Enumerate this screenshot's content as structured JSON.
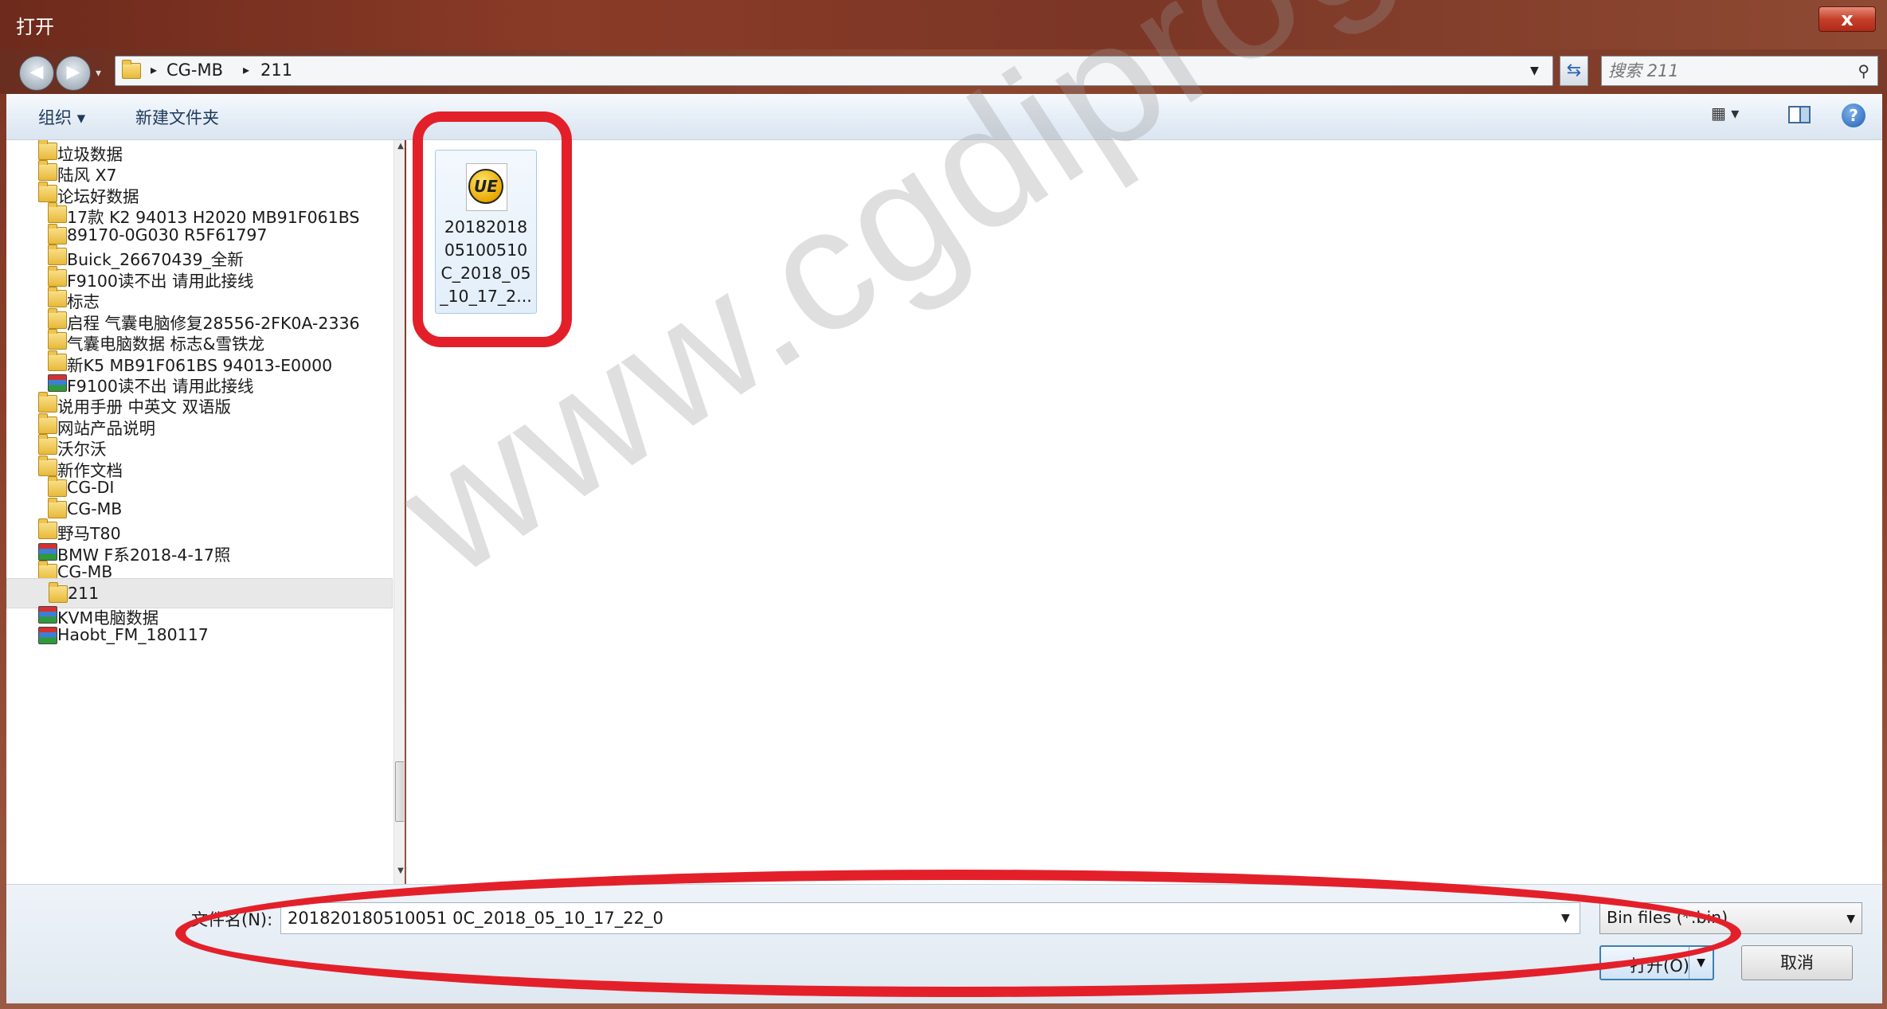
{
  "window": {
    "title": "打开",
    "close_label": "x"
  },
  "address": {
    "crumbs": [
      "CG-MB",
      "211"
    ],
    "search_placeholder": "搜索 211"
  },
  "toolbar": {
    "organize_label": "组织 ▾",
    "new_folder_label": "新建文件夹"
  },
  "nav_tree": [
    {
      "label": "垃圾数据",
      "icon": "folder-icon"
    },
    {
      "label": "陆风 X7",
      "icon": "folder-icon"
    },
    {
      "label": "论坛好数据",
      "icon": "folder-icon"
    },
    {
      "label": "17款 K2  94013 H2020 MB91F061BS",
      "icon": "folder-icon"
    },
    {
      "label": "89170-0G030    R5F61797",
      "icon": "folder-icon"
    },
    {
      "label": "Buick_26670439_全新",
      "icon": "folder-icon"
    },
    {
      "label": "F9100读不出 请用此接线",
      "icon": "folder-icon"
    },
    {
      "label": "标志",
      "icon": "folder-icon"
    },
    {
      "label": "启程 气囊电脑修复28556-2FK0A-2336",
      "icon": "folder-icon"
    },
    {
      "label": "气囊电脑数据  标志&雪铁龙",
      "icon": "folder-icon"
    },
    {
      "label": "新K5    MB91F061BS    94013-E0000",
      "icon": "folder-icon"
    },
    {
      "label": "F9100读不出 请用此接线",
      "icon": "rar-archive-icon"
    },
    {
      "label": "说用手册 中英文 双语版",
      "icon": "folder-icon"
    },
    {
      "label": "网站产品说明",
      "icon": "folder-icon"
    },
    {
      "label": "沃尔沃",
      "icon": "folder-icon"
    },
    {
      "label": "新作文档",
      "icon": "folder-icon"
    },
    {
      "label": "CG-DI",
      "icon": "folder-icon"
    },
    {
      "label": "CG-MB",
      "icon": "folder-icon"
    },
    {
      "label": "野马T80",
      "icon": "folder-icon"
    },
    {
      "label": "BMW F系2018-4-17照",
      "icon": "rar-archive-icon"
    },
    {
      "label": "CG-MB",
      "icon": "folder-icon"
    },
    {
      "label": "211",
      "icon": "folder-icon",
      "selected": true
    },
    {
      "label": "KVM电脑数据",
      "icon": "rar-archive-icon"
    },
    {
      "label": "Haobt_FM_180117",
      "icon": "rar-archive-icon"
    }
  ],
  "file": {
    "name_lines": [
      "20182018",
      "05100510",
      "C_2018_05",
      "_10_17_2..."
    ],
    "icon": "ultraedit-file-icon",
    "icon_text": "UE"
  },
  "bottom": {
    "filename_label": "文件名(N):",
    "filename_value": "201820180510051 0C_2018_05_10_17_22_0",
    "filetype_value": "Bin files (*.bin)",
    "open_label": "打开(O)",
    "cancel_label": "取消"
  },
  "watermark": "www.cgdiprog.com",
  "colors": {
    "annotation": "#e3202a",
    "title_bar": "#8a3b27"
  }
}
